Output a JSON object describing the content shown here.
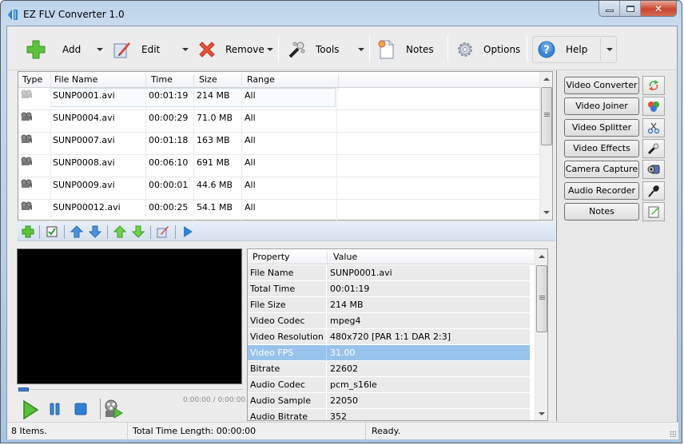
{
  "window": {
    "title": "EZ FLV Converter 1.0",
    "controls": [
      "minimize",
      "maximize",
      "close"
    ]
  },
  "toolbar": {
    "buttons": [
      {
        "label": "Add",
        "icon": "green-plus-icon",
        "has_dropdown": true
      },
      {
        "label": "Edit",
        "icon": "edit-pencil-icon",
        "has_dropdown": true
      },
      {
        "label": "Remove",
        "icon": "red-x-icon",
        "has_dropdown": true
      },
      {
        "label": "Tools",
        "icon": "magic-wand-icon",
        "has_dropdown": true
      },
      {
        "label": "Notes",
        "icon": "note-page-icon",
        "has_dropdown": false
      },
      {
        "label": "Options",
        "icon": "gear-icon",
        "has_dropdown": false
      },
      {
        "label": "Help",
        "icon": "help-question-icon",
        "has_dropdown": true
      }
    ]
  },
  "file_list": {
    "columns": [
      "Type",
      "File Name",
      "Time",
      "Size",
      "Range"
    ],
    "rows": [
      {
        "type_icon": "video-camera-icon",
        "name": "SUNP0001.avi",
        "time": "00:01:19",
        "size": "214 MB",
        "range": "All",
        "selected": true
      },
      {
        "type_icon": "video-camera-icon",
        "name": "SUNP0004.avi",
        "time": "00:00:29",
        "size": "71.0 MB",
        "range": "All"
      },
      {
        "type_icon": "video-camera-icon",
        "name": "SUNP0007.avi",
        "time": "00:01:18",
        "size": "163 MB",
        "range": "All"
      },
      {
        "type_icon": "video-camera-icon",
        "name": "SUNP0008.avi",
        "time": "00:06:10",
        "size": "691 MB",
        "range": "All"
      },
      {
        "type_icon": "video-camera-icon",
        "name": "SUNP0009.avi",
        "time": "00:00:01",
        "size": "44.6 MB",
        "range": "All"
      },
      {
        "type_icon": "video-camera-icon",
        "name": "SUNP00012.avi",
        "time": "00:00:25",
        "size": "54.1 MB",
        "range": "All"
      }
    ]
  },
  "list_toolbar": {
    "icons": [
      "add-icon",
      "check-all-icon",
      "move-up-icon",
      "move-down-icon",
      "move-top-icon",
      "move-bottom-icon",
      "edit-icon",
      "play-icon"
    ]
  },
  "player": {
    "time_readout": "0:00:00 / 0:00:00",
    "seek_progress": 0,
    "controls": [
      "play-icon",
      "pause-icon",
      "stop-icon",
      "film-reel-play-icon"
    ]
  },
  "properties": {
    "columns": [
      "Property",
      "Value"
    ],
    "rows": [
      {
        "key": "File Name",
        "value": "SUNP0001.avi"
      },
      {
        "key": "Total Time",
        "value": "00:01:19"
      },
      {
        "key": "File Size",
        "value": "214 MB"
      },
      {
        "key": "Video Codec",
        "value": "mpeg4"
      },
      {
        "key": "Video Resolution",
        "value": "480x720 [PAR 1:1 DAR 2:3]"
      },
      {
        "key": "Video FPS",
        "value": "31.00",
        "selected": true
      },
      {
        "key": "Bitrate",
        "value": "22602"
      },
      {
        "key": "Audio Codec",
        "value": "pcm_s16le"
      },
      {
        "key": "Audio Sample",
        "value": "22050"
      },
      {
        "key": "Audio Bitrate",
        "value": "352"
      }
    ]
  },
  "right_panel": {
    "buttons": [
      {
        "label": "Video Converter",
        "icon": "convert-arrows-icon"
      },
      {
        "label": "Video Joiner",
        "icon": "joiner-circles-icon"
      },
      {
        "label": "Video Splitter",
        "icon": "scissors-icon"
      },
      {
        "label": "Video Effects",
        "icon": "magic-wand-icon"
      },
      {
        "label": "Camera Capture",
        "icon": "webcam-icon"
      },
      {
        "label": "Audio Recorder",
        "icon": "microphone-icon"
      },
      {
        "label": "Notes",
        "icon": "note-edit-icon"
      }
    ]
  },
  "status_bar": {
    "items": "8 Items.",
    "total_time": "Total Time Length: 00:00:00",
    "status": "Ready."
  }
}
